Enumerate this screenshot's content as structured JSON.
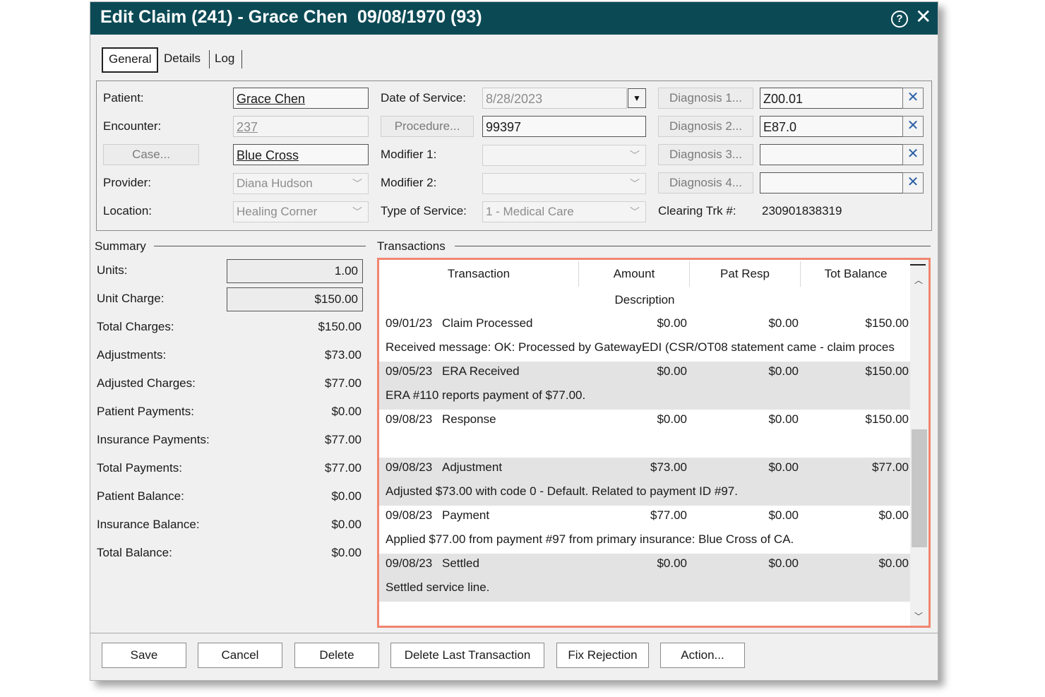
{
  "window": {
    "title": "Edit Claim (241) - Grace Chen  09/08/1970 (93)"
  },
  "tabs": [
    "General",
    "Details",
    "Log"
  ],
  "general": {
    "patient_label": "Patient:",
    "patient_value": "Grace Chen",
    "encounter_label": "Encounter:",
    "encounter_value": "237",
    "case_button": "Case...",
    "case_value": "Blue Cross",
    "provider_label": "Provider:",
    "provider_value": "Diana Hudson",
    "location_label": "Location:",
    "location_value": "Healing Corner",
    "dos_label": "Date of Service:",
    "dos_value": "8/28/2023",
    "procedure_button": "Procedure...",
    "procedure_value": "99397",
    "modifier1_label": "Modifier 1:",
    "modifier1_value": "",
    "modifier2_label": "Modifier 2:",
    "modifier2_value": "",
    "tos_label": "Type of Service:",
    "tos_value": "1 - Medical Care",
    "diagnosis": [
      {
        "label": "Diagnosis 1...",
        "value": "Z00.01"
      },
      {
        "label": "Diagnosis 2...",
        "value": "E87.0"
      },
      {
        "label": "Diagnosis 3...",
        "value": ""
      },
      {
        "label": "Diagnosis 4...",
        "value": ""
      }
    ],
    "clearing_label": "Clearing Trk #:",
    "clearing_value": "230901838319"
  },
  "summary": {
    "title": "Summary",
    "rows": [
      {
        "label": "Units:",
        "value": "1.00"
      },
      {
        "label": "Unit Charge:",
        "value": "$150.00"
      },
      {
        "label": "Total Charges:",
        "value": "$150.00"
      },
      {
        "label": "Adjustments:",
        "value": "$73.00"
      },
      {
        "label": "Adjusted Charges:",
        "value": "$77.00"
      },
      {
        "label": "Patient Payments:",
        "value": "$0.00"
      },
      {
        "label": "Insurance Payments:",
        "value": "$77.00"
      },
      {
        "label": "Total Payments:",
        "value": "$77.00"
      },
      {
        "label": "Patient Balance:",
        "value": "$0.00"
      },
      {
        "label": "Insurance Balance:",
        "value": "$0.00"
      },
      {
        "label": "Total Balance:",
        "value": "$0.00"
      }
    ]
  },
  "transactions": {
    "title": "Transactions",
    "columns": [
      "Transaction",
      "Amount",
      "Pat Resp",
      "Tot Balance"
    ],
    "subheader": "Description",
    "rows": [
      {
        "date": "09/01/23",
        "type": "Claim Processed",
        "amount": "$0.00",
        "pat_resp": "$0.00",
        "tot_balance": "$150.00",
        "description": "Received message: OK: Processed by GatewayEDI (CSR/OT08 statement came - claim proces"
      },
      {
        "date": "09/05/23",
        "type": "ERA Received",
        "amount": "$0.00",
        "pat_resp": "$0.00",
        "tot_balance": "$150.00",
        "description": "ERA #110 reports payment of $77.00."
      },
      {
        "date": "09/08/23",
        "type": "Response",
        "amount": "$0.00",
        "pat_resp": "$0.00",
        "tot_balance": "$150.00",
        "description": ""
      },
      {
        "date": "09/08/23",
        "type": "Adjustment",
        "amount": "$73.00",
        "pat_resp": "$0.00",
        "tot_balance": "$77.00",
        "description": "Adjusted $73.00 with code 0 - Default. Related to payment ID #97."
      },
      {
        "date": "09/08/23",
        "type": "Payment",
        "amount": "$77.00",
        "pat_resp": "$0.00",
        "tot_balance": "$0.00",
        "description": "Applied $77.00 from payment #97 from primary insurance: Blue Cross of CA."
      },
      {
        "date": "09/08/23",
        "type": "Settled",
        "amount": "$0.00",
        "pat_resp": "$0.00",
        "tot_balance": "$0.00",
        "description": "Settled service line."
      }
    ]
  },
  "footer": {
    "save": "Save",
    "cancel": "Cancel",
    "delete": "Delete",
    "delete_last": "Delete Last Transaction",
    "fix_rejection": "Fix Rejection",
    "action": "Action..."
  },
  "colors": {
    "titlebar": "#0b4a55",
    "highlight_border": "#f08670",
    "row_shade": "#e3e3e3"
  }
}
